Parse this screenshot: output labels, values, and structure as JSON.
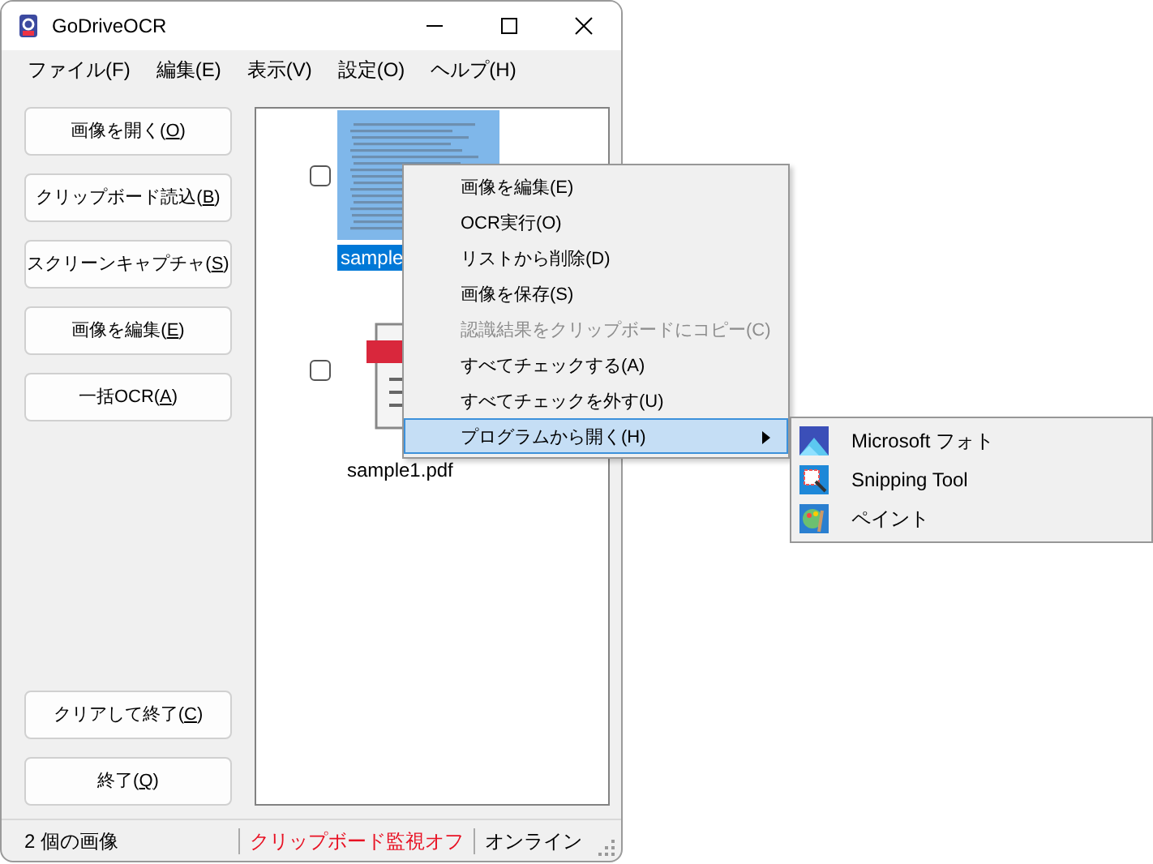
{
  "window": {
    "title": "GoDriveOCR"
  },
  "menu_bar": [
    "ファイル(F)",
    "編集(E)",
    "表示(V)",
    "設定(O)",
    "ヘルプ(H)"
  ],
  "side_buttons_top": [
    {
      "label": "画像を開く(O)",
      "underline_key": true
    },
    {
      "label": "クリップボード読込(B)",
      "underline_key": true
    },
    {
      "label": "スクリーンキャプチャ(S)",
      "underline_key": true
    },
    {
      "label": "画像を編集(E)",
      "underline_key": true
    },
    {
      "label": "一括OCR(A)",
      "underline_key": true
    }
  ],
  "side_buttons_bottom": [
    {
      "label": "クリアして終了(C)",
      "underline_key": true
    },
    {
      "label": "終了(Q)",
      "underline_key": true
    }
  ],
  "files": [
    {
      "name": "sample",
      "checked": false,
      "selected": true
    },
    {
      "kind": "pdf",
      "name": "sample1.pdf",
      "checked": false,
      "selected": false
    }
  ],
  "context_menu": [
    {
      "label": "画像を編集(E)",
      "disabled": false,
      "selected": false,
      "submenu": false
    },
    {
      "label": "OCR実行(O)",
      "disabled": false,
      "selected": false,
      "submenu": false
    },
    {
      "label": "リストから削除(D)",
      "disabled": false,
      "selected": false,
      "submenu": false
    },
    {
      "label": "画像を保存(S)",
      "disabled": false,
      "selected": false,
      "submenu": false
    },
    {
      "label": "認識結果をクリップボードにコピー(C)",
      "disabled": true,
      "selected": false,
      "submenu": false
    },
    {
      "label": "すべてチェックする(A)",
      "disabled": false,
      "selected": false,
      "submenu": false
    },
    {
      "label": "すべてチェックを外す(U)",
      "disabled": false,
      "selected": false,
      "submenu": false
    },
    {
      "label": "プログラムから開く(H)",
      "disabled": false,
      "selected": true,
      "submenu": true
    }
  ],
  "submenu": [
    {
      "kind": "photos",
      "label": "Microsoft フォト"
    },
    {
      "kind": "snip",
      "label": "Snipping Tool"
    },
    {
      "kind": "paint",
      "label": "ペイント"
    }
  ],
  "status_bar": [
    {
      "text": "2 個の画像",
      "color": "#000000"
    },
    {
      "text": "クリップボード監視オフ",
      "color": "#e81123"
    },
    {
      "text": "オンライン",
      "color": "#000000"
    }
  ]
}
